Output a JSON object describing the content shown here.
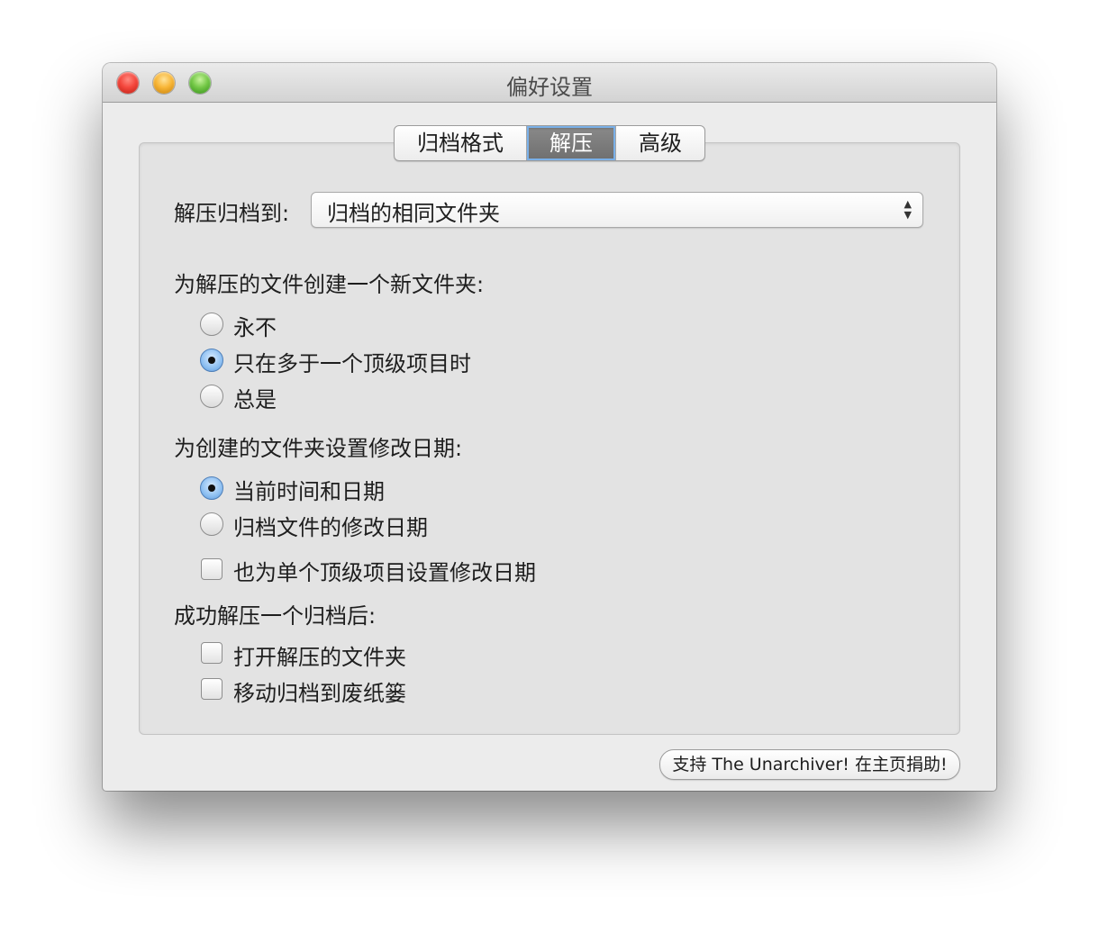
{
  "window": {
    "title": "偏好设置"
  },
  "tabs": [
    {
      "label": "归档格式",
      "selected": false
    },
    {
      "label": "解压",
      "selected": true
    },
    {
      "label": "高级",
      "selected": false
    }
  ],
  "extract": {
    "label": "解压归档到:",
    "selected_value": "归档的相同文件夹"
  },
  "new_folder": {
    "heading": "为解压的文件创建一个新文件夹:",
    "options": [
      {
        "label": "永不",
        "checked": false
      },
      {
        "label": "只在多于一个顶级项目时",
        "checked": true
      },
      {
        "label": "总是",
        "checked": false
      }
    ]
  },
  "modify_date": {
    "heading": "为创建的文件夹设置修改日期:",
    "options": [
      {
        "label": "当前时间和日期",
        "checked": true
      },
      {
        "label": "归档文件的修改日期",
        "checked": false
      }
    ],
    "single_item_checkbox": {
      "label": "也为单个顶级项目设置修改日期",
      "checked": false
    }
  },
  "after_extract": {
    "heading": "成功解压一个归档后:",
    "checkboxes": [
      {
        "label": "打开解压的文件夹",
        "checked": false
      },
      {
        "label": "移动归档到废纸篓",
        "checked": false
      }
    ]
  },
  "support_button": {
    "label": "支持 The Unarchiver! 在主页捐助!"
  }
}
